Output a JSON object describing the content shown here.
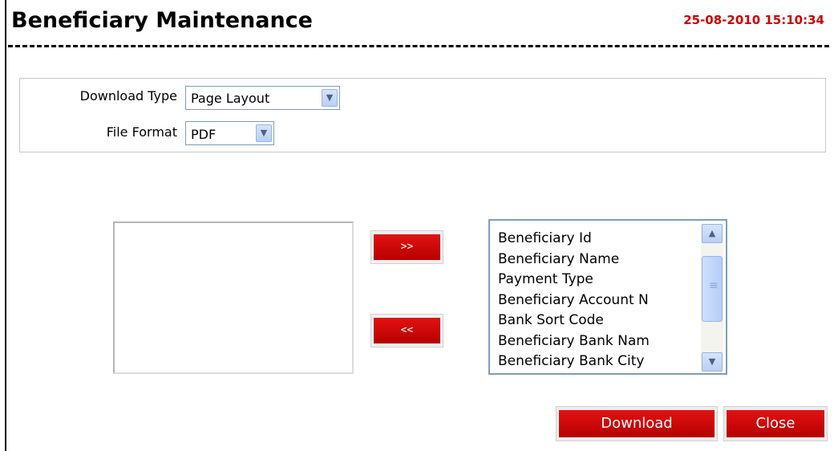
{
  "header": {
    "title": "Beneficiary Maintenance",
    "timestamp": "25-08-2010 15:10:34"
  },
  "options": {
    "download_type": {
      "label": "Download Type",
      "value": "Page Layout"
    },
    "file_format": {
      "label": "File Format",
      "value": "PDF"
    }
  },
  "columns": {
    "available": [
      "Beneficiary Id",
      "Beneficiary Name",
      "Payment Type",
      "Beneficiary Account N",
      "Bank Sort Code",
      "Beneficiary Bank Nam",
      "Beneficiary Bank City"
    ],
    "selected": []
  },
  "buttons": {
    "add_label": ">>",
    "remove_label": "<<",
    "download_label": "Download",
    "close_label": "Close"
  },
  "colors": {
    "accent_red": "#cc0000",
    "button_red": "#d10808",
    "scroll_blue": "#b9cff5"
  }
}
